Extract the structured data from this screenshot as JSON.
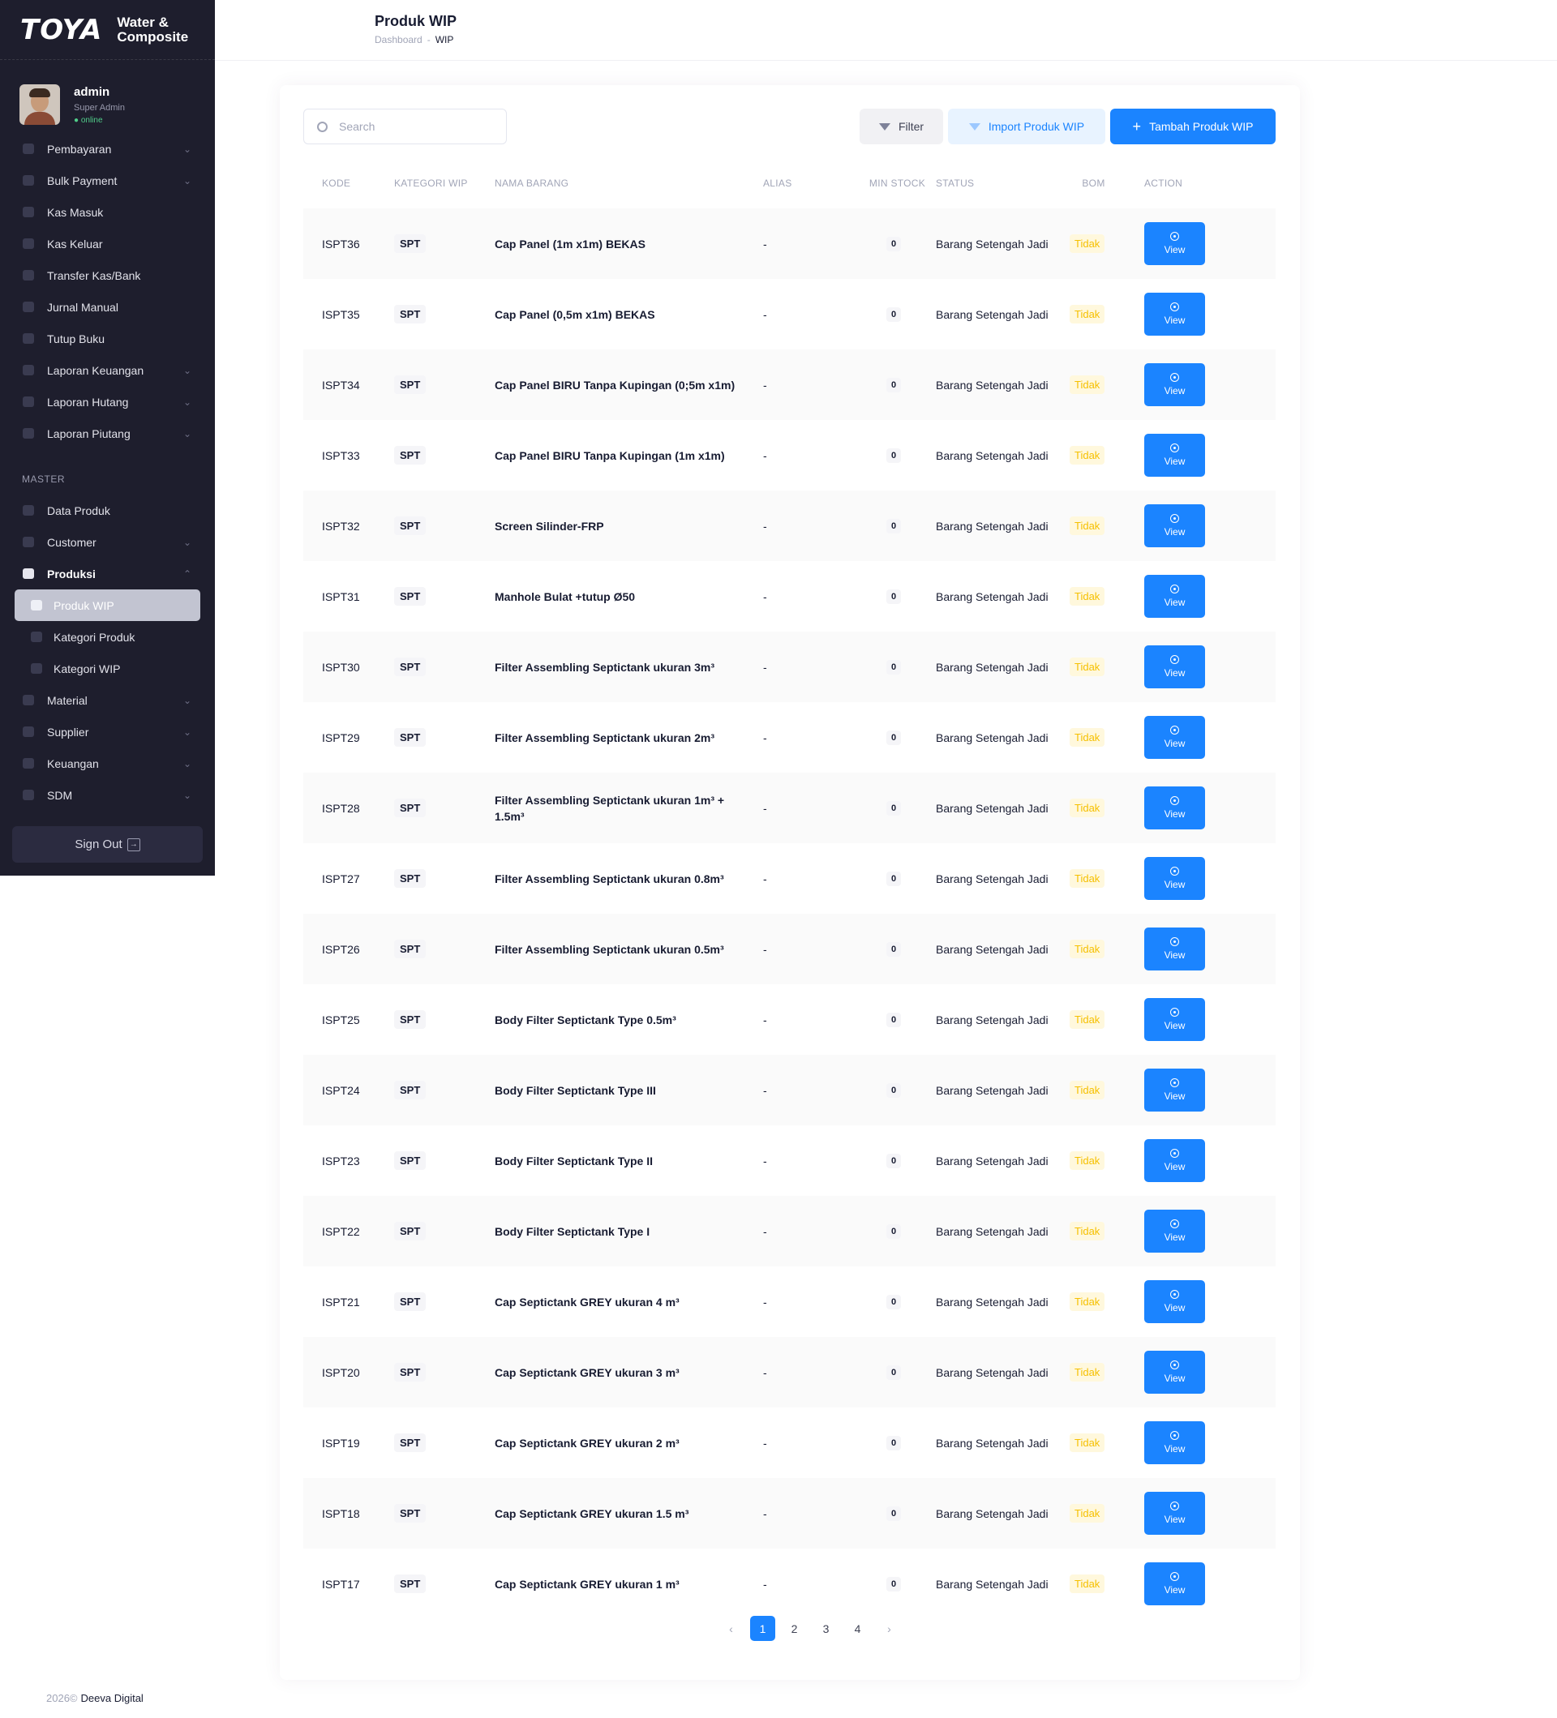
{
  "brand": {
    "logo": "TOYA",
    "sub_line1": "Water &",
    "sub_line2": "Composite"
  },
  "user": {
    "name": "admin",
    "role": "Super Admin",
    "status": "● online"
  },
  "sidebar": {
    "items": [
      {
        "label": "Pembayaran",
        "icon": "payment-icon",
        "chevron": true
      },
      {
        "label": "Bulk Payment",
        "icon": "bulk-payment-icon",
        "chevron": true
      },
      {
        "label": "Kas Masuk",
        "icon": "arrow-down-icon",
        "chevron": false
      },
      {
        "label": "Kas Keluar",
        "icon": "arrow-up-icon",
        "chevron": false
      },
      {
        "label": "Transfer Kas/Bank",
        "icon": "transfer-icon",
        "chevron": false
      },
      {
        "label": "Jurnal Manual",
        "icon": "journal-icon",
        "chevron": false
      },
      {
        "label": "Tutup Buku",
        "icon": "calendar-icon",
        "chevron": false
      },
      {
        "label": "Laporan Keuangan",
        "icon": "report-icon",
        "chevron": true
      },
      {
        "label": "Laporan Hutang",
        "icon": "chevron-up-icon",
        "chevron": true
      },
      {
        "label": "Laporan Piutang",
        "icon": "chevron-down-icon",
        "chevron": true
      }
    ],
    "master_title": "MASTER",
    "master_items": [
      {
        "label": "Data Produk",
        "chevron": false
      },
      {
        "label": "Customer",
        "chevron": true
      },
      {
        "label": "Produksi",
        "chevron": true,
        "open": true
      },
      {
        "label": "Material",
        "chevron": true
      },
      {
        "label": "Supplier",
        "chevron": true
      },
      {
        "label": "Keuangan",
        "chevron": true
      },
      {
        "label": "SDM",
        "chevron": true
      }
    ],
    "produksi_sub": [
      "Produk WIP",
      "Kategori Produk",
      "Kategori WIP"
    ],
    "signout": "Sign Out"
  },
  "header": {
    "title": "Produk WIP",
    "breadcrumb": [
      "Dashboard",
      "WIP"
    ]
  },
  "toolbar": {
    "search_placeholder": "Search",
    "filter_label": "Filter",
    "import_label": "Import Produk WIP",
    "add_label": "Tambah Produk WIP"
  },
  "table": {
    "columns": [
      "KODE",
      "KATEGORI WIP",
      "NAMA BARANG",
      "ALIAS",
      "MIN STOCK",
      "STATUS",
      "BOM",
      "ACTION"
    ],
    "rows": [
      {
        "kode": "ISPT36",
        "kategori": "SPT",
        "nama": "Cap Panel (1m x1m) BEKAS",
        "alias": "-",
        "min_stock": "0",
        "status": "Barang Setengah Jadi",
        "bom": "Tidak",
        "action": "View"
      },
      {
        "kode": "ISPT35",
        "kategori": "SPT",
        "nama": "Cap Panel (0,5m x1m) BEKAS",
        "alias": "-",
        "min_stock": "0",
        "status": "Barang Setengah Jadi",
        "bom": "Tidak",
        "action": "View"
      },
      {
        "kode": "ISPT34",
        "kategori": "SPT",
        "nama": "Cap Panel BIRU Tanpa Kupingan (0;5m x1m)",
        "alias": "-",
        "min_stock": "0",
        "status": "Barang Setengah Jadi",
        "bom": "Tidak",
        "action": "View"
      },
      {
        "kode": "ISPT33",
        "kategori": "SPT",
        "nama": "Cap Panel BIRU Tanpa Kupingan (1m x1m)",
        "alias": "-",
        "min_stock": "0",
        "status": "Barang Setengah Jadi",
        "bom": "Tidak",
        "action": "View"
      },
      {
        "kode": "ISPT32",
        "kategori": "SPT",
        "nama": "Screen Silinder-FRP",
        "alias": "-",
        "min_stock": "0",
        "status": "Barang Setengah Jadi",
        "bom": "Tidak",
        "action": "View"
      },
      {
        "kode": "ISPT31",
        "kategori": "SPT",
        "nama": "Manhole Bulat +tutup Ø50",
        "alias": "-",
        "min_stock": "0",
        "status": "Barang Setengah Jadi",
        "bom": "Tidak",
        "action": "View"
      },
      {
        "kode": "ISPT30",
        "kategori": "SPT",
        "nama": "Filter Assembling Septictank ukuran 3m³",
        "alias": "-",
        "min_stock": "0",
        "status": "Barang Setengah Jadi",
        "bom": "Tidak",
        "action": "View"
      },
      {
        "kode": "ISPT29",
        "kategori": "SPT",
        "nama": "Filter Assembling Septictank ukuran 2m³",
        "alias": "-",
        "min_stock": "0",
        "status": "Barang Setengah Jadi",
        "bom": "Tidak",
        "action": "View"
      },
      {
        "kode": "ISPT28",
        "kategori": "SPT",
        "nama": "Filter Assembling Septictank ukuran 1m³ + 1.5m³",
        "alias": "-",
        "min_stock": "0",
        "status": "Barang Setengah Jadi",
        "bom": "Tidak",
        "action": "View"
      },
      {
        "kode": "ISPT27",
        "kategori": "SPT",
        "nama": "Filter Assembling Septictank ukuran 0.8m³",
        "alias": "-",
        "min_stock": "0",
        "status": "Barang Setengah Jadi",
        "bom": "Tidak",
        "action": "View"
      },
      {
        "kode": "ISPT26",
        "kategori": "SPT",
        "nama": "Filter Assembling Septictank ukuran 0.5m³",
        "alias": "-",
        "min_stock": "0",
        "status": "Barang Setengah Jadi",
        "bom": "Tidak",
        "action": "View"
      },
      {
        "kode": "ISPT25",
        "kategori": "SPT",
        "nama": "Body Filter Septictank Type 0.5m³",
        "alias": "-",
        "min_stock": "0",
        "status": "Barang Setengah Jadi",
        "bom": "Tidak",
        "action": "View"
      },
      {
        "kode": "ISPT24",
        "kategori": "SPT",
        "nama": "Body Filter Septictank Type III",
        "alias": "-",
        "min_stock": "0",
        "status": "Barang Setengah Jadi",
        "bom": "Tidak",
        "action": "View"
      },
      {
        "kode": "ISPT23",
        "kategori": "SPT",
        "nama": "Body Filter Septictank Type II",
        "alias": "-",
        "min_stock": "0",
        "status": "Barang Setengah Jadi",
        "bom": "Tidak",
        "action": "View"
      },
      {
        "kode": "ISPT22",
        "kategori": "SPT",
        "nama": "Body Filter Septictank Type I",
        "alias": "-",
        "min_stock": "0",
        "status": "Barang Setengah Jadi",
        "bom": "Tidak",
        "action": "View"
      },
      {
        "kode": "ISPT21",
        "kategori": "SPT",
        "nama": "Cap Septictank GREY ukuran 4 m³",
        "alias": "-",
        "min_stock": "0",
        "status": "Barang Setengah Jadi",
        "bom": "Tidak",
        "action": "View"
      },
      {
        "kode": "ISPT20",
        "kategori": "SPT",
        "nama": "Cap Septictank GREY ukuran 3 m³",
        "alias": "-",
        "min_stock": "0",
        "status": "Barang Setengah Jadi",
        "bom": "Tidak",
        "action": "View"
      },
      {
        "kode": "ISPT19",
        "kategori": "SPT",
        "nama": "Cap Septictank GREY ukuran 2 m³",
        "alias": "-",
        "min_stock": "0",
        "status": "Barang Setengah Jadi",
        "bom": "Tidak",
        "action": "View"
      },
      {
        "kode": "ISPT18",
        "kategori": "SPT",
        "nama": "Cap Septictank GREY ukuran 1.5 m³",
        "alias": "-",
        "min_stock": "0",
        "status": "Barang Setengah Jadi",
        "bom": "Tidak",
        "action": "View"
      },
      {
        "kode": "ISPT17",
        "kategori": "SPT",
        "nama": "Cap Septictank GREY ukuran 1 m³",
        "alias": "-",
        "min_stock": "0",
        "status": "Barang Setengah Jadi",
        "bom": "Tidak",
        "action": "View"
      }
    ]
  },
  "pagination": {
    "prev": "‹",
    "next": "›",
    "pages": [
      "1",
      "2",
      "3",
      "4"
    ],
    "current": "1"
  },
  "footer": {
    "year": "2026©",
    "company": "Deeva Digital"
  },
  "colors": {
    "primary": "#1b84ff",
    "sidebar_bg": "#1e1e2d",
    "warning": "#f6c000",
    "warning_bg": "#fff8dd"
  }
}
